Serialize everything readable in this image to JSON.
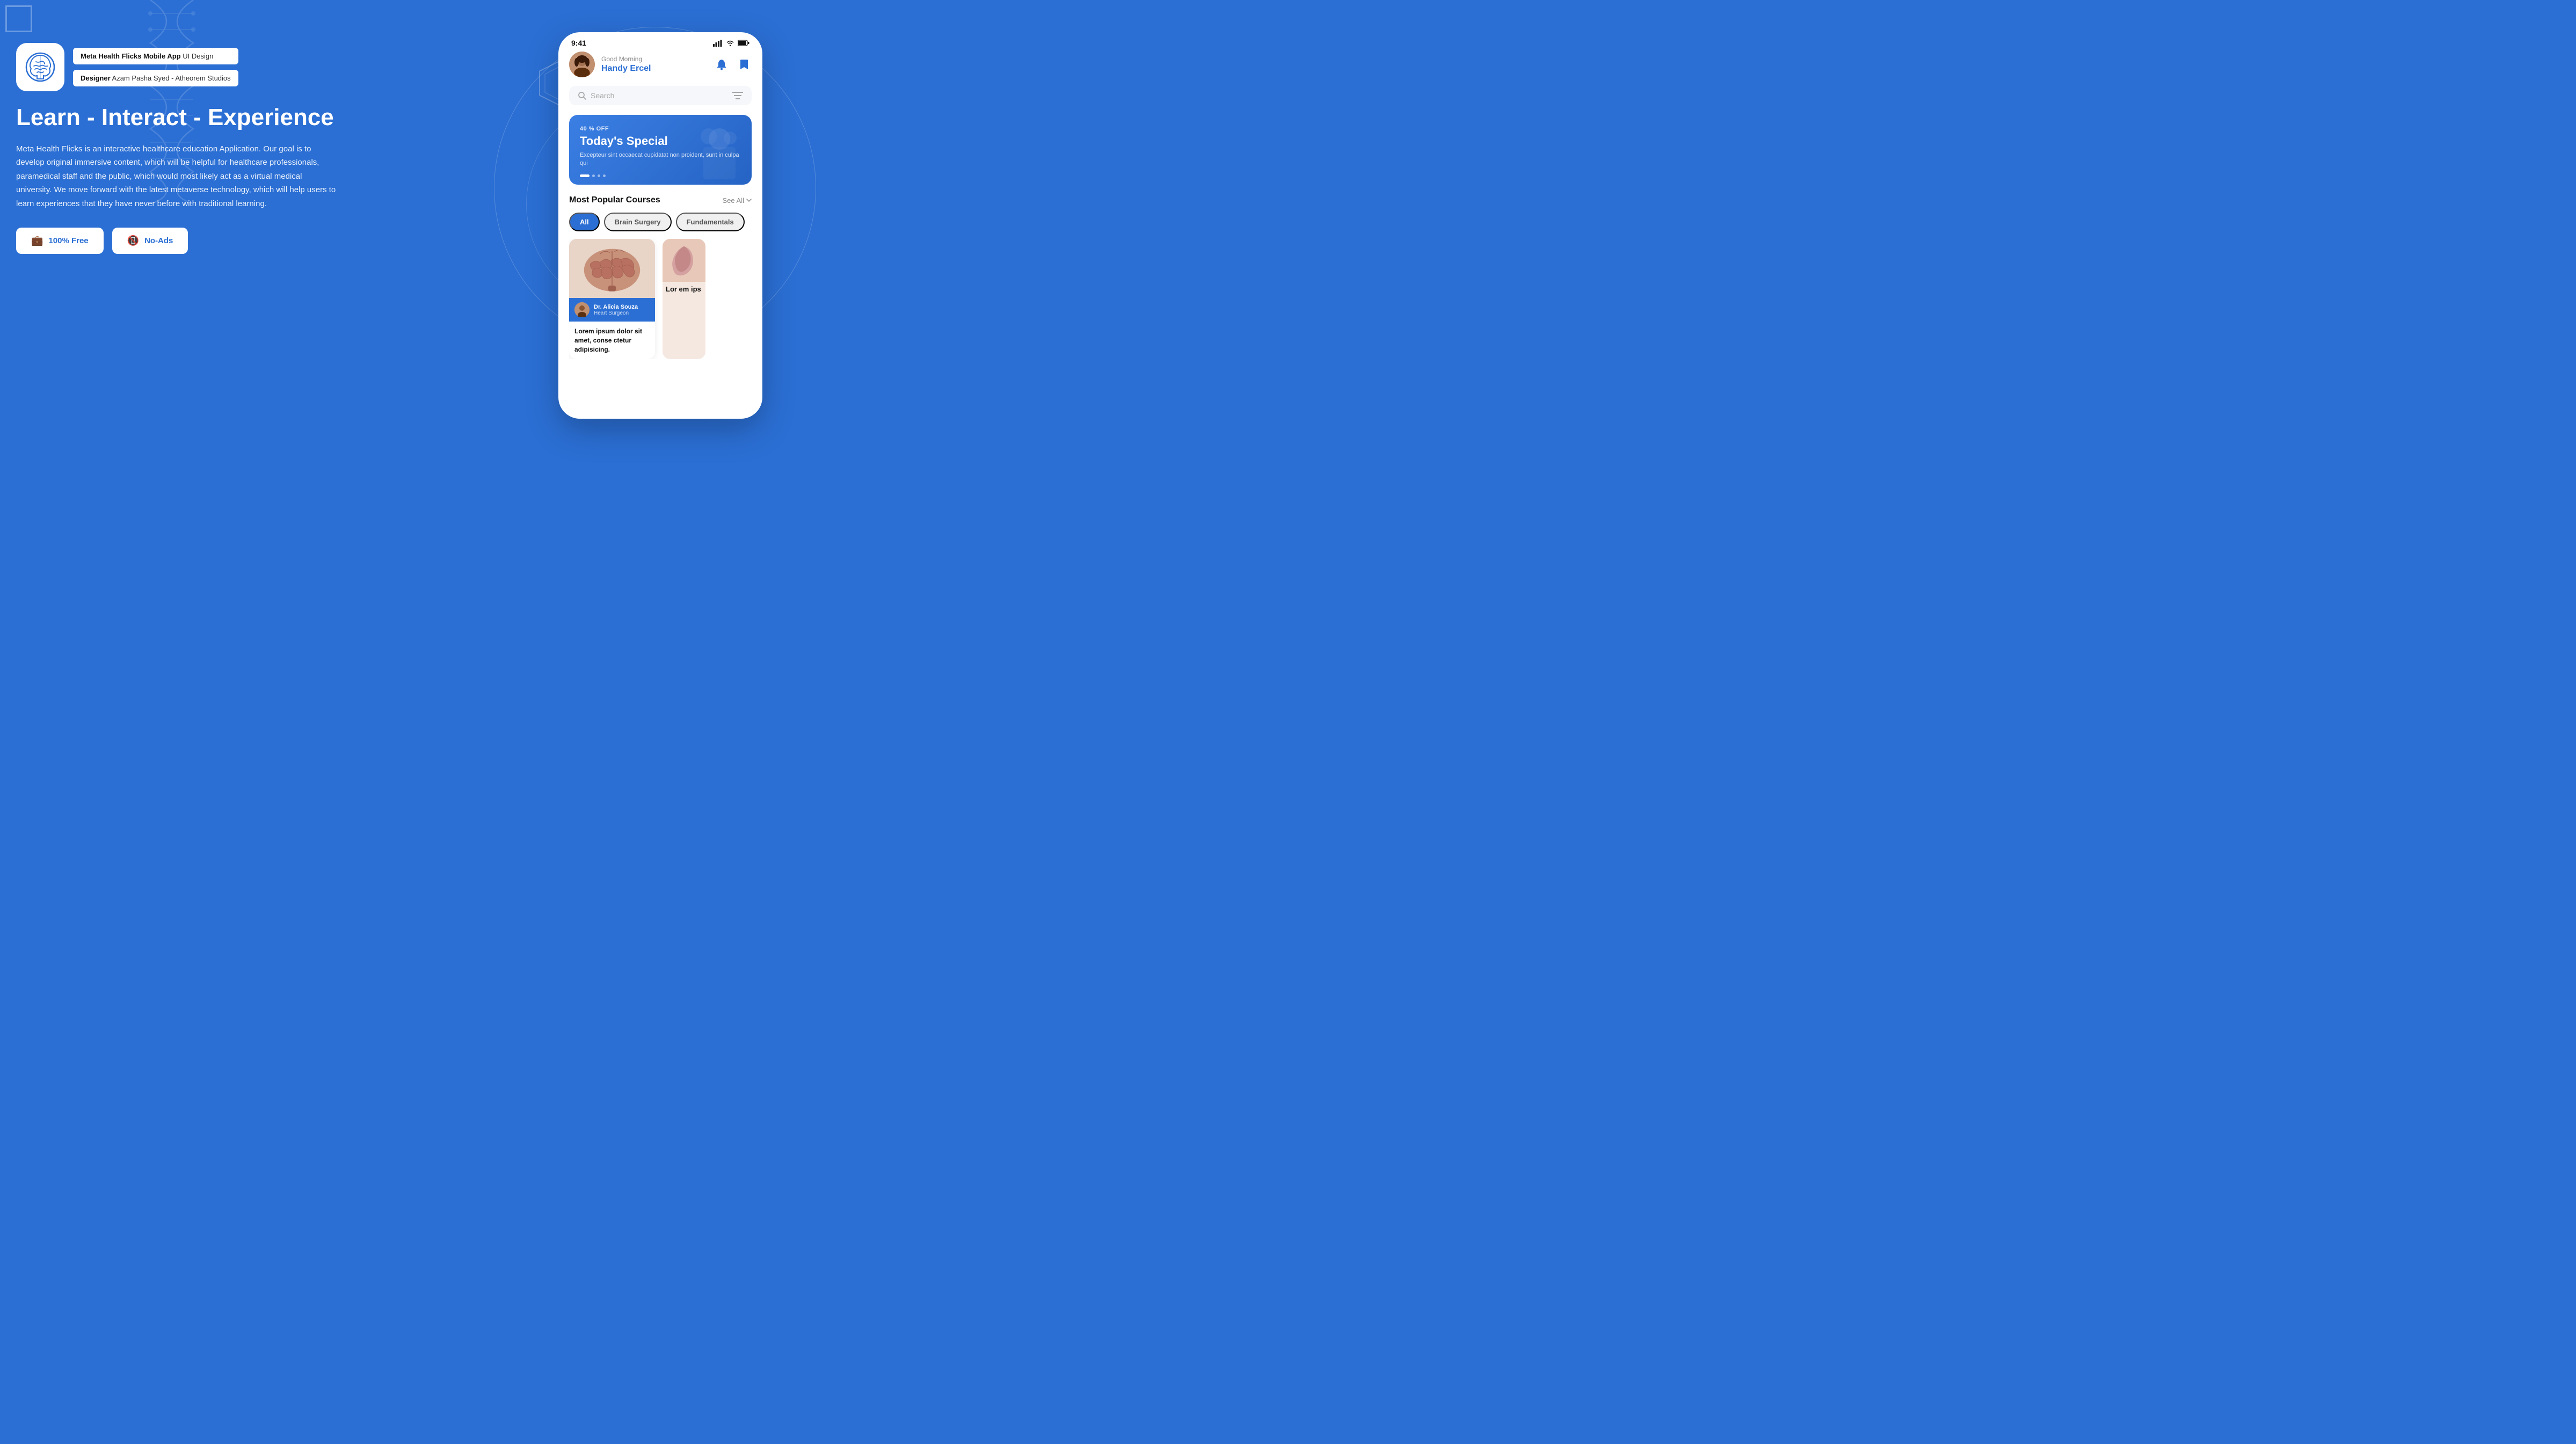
{
  "background": {
    "color": "#2B6FD4"
  },
  "app_logo": {
    "alt": "Meta Health Flicks Logo"
  },
  "badge": {
    "app_name_label": "Meta Health Flicks Mobile App",
    "app_name_suffix": " UI Design",
    "designer_label": "Designer",
    "designer_name": " Azam Pasha Syed - Atheorem Studios"
  },
  "headline": "Learn - Interact - Experience",
  "description": "Meta Health Flicks is an interactive healthcare education Application. Our goal is to develop original immersive content, which will be helpful for healthcare professionals, paramedical staff and the public, which would most likely act as a virtual medical university. We move forward with the latest metaverse technology, which will help users to learn experiences that they have never before with traditional learning.",
  "cta": {
    "free_label": "100% Free",
    "no_ads_label": "No-Ads"
  },
  "phone": {
    "status_time": "9:41",
    "greeting": "Good Morning",
    "user_name": "Handy Ercel",
    "search_placeholder": "Search",
    "promo": {
      "discount": "40 % OFF",
      "title": "Today's Special",
      "description": "Excepteur sint occaecat cupidatat non proident, sunt in culpa qui"
    },
    "popular_courses": {
      "section_title": "Most Popular Courses",
      "see_all": "See All",
      "filters": [
        "All",
        "Brain Surgery",
        "Fundamentals"
      ],
      "cards": [
        {
          "author_name": "Dr. Alicia Souza",
          "author_role": "Heart Surgeon",
          "description": "Lorem ipsum dolor sit amet, conse ctetur adipisicing."
        },
        {
          "description": "Lor em ips"
        }
      ]
    }
  }
}
